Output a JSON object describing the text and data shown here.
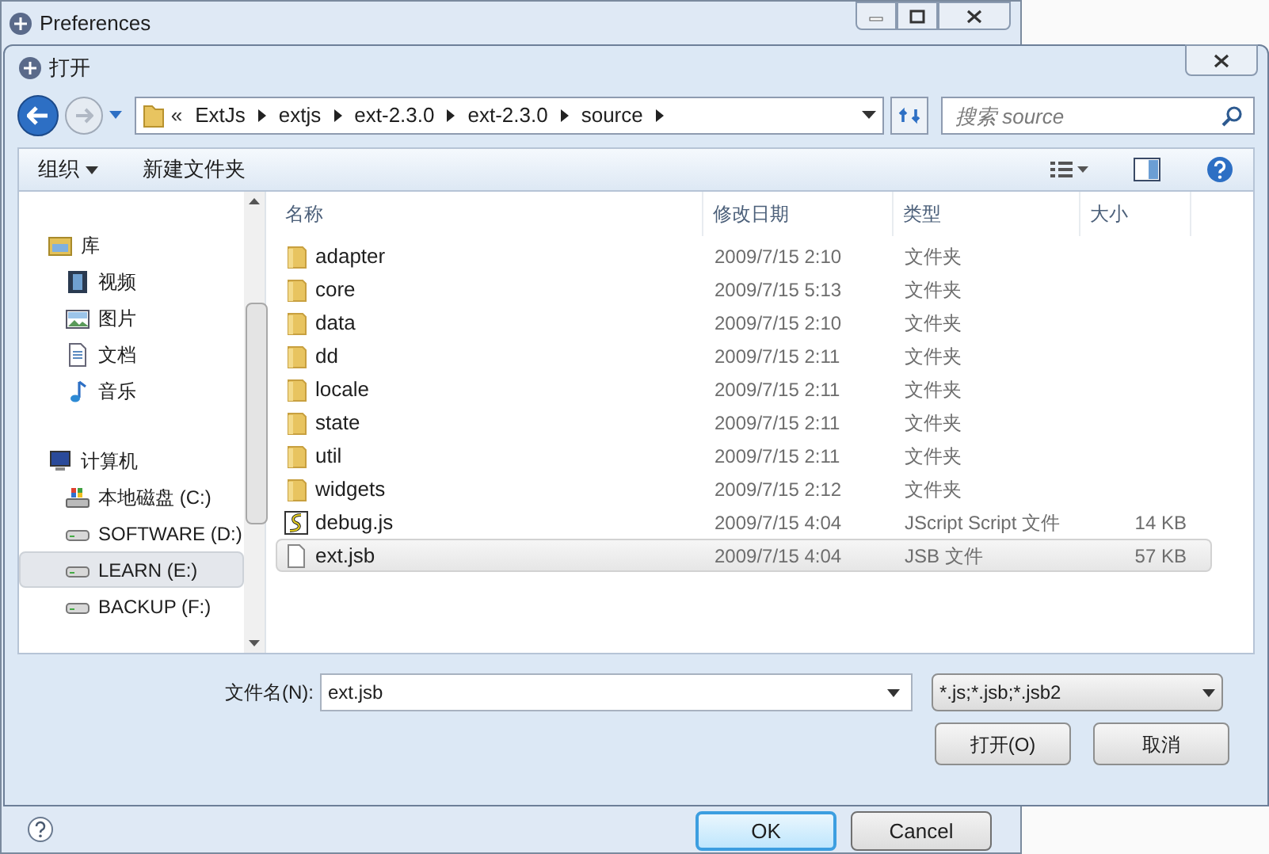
{
  "background_window": {
    "title": "Preferences",
    "buttons": [
      {
        "label": "OK",
        "default": true
      },
      {
        "label": "Cancel",
        "default": false
      }
    ]
  },
  "dialog": {
    "title": "打开",
    "breadcrumb": {
      "overflow": "«",
      "segments": [
        "ExtJs",
        "extjs",
        "ext-2.3.0",
        "ext-2.3.0",
        "source"
      ]
    },
    "search": {
      "placeholder": "搜索 source"
    },
    "toolbar": {
      "organize": "组织",
      "new_folder": "新建文件夹"
    },
    "sidebar": [
      {
        "label": "库",
        "kind": "library",
        "children": [
          {
            "label": "视频",
            "kind": "video",
            "selected": false
          },
          {
            "label": "图片",
            "kind": "picture",
            "selected": false
          },
          {
            "label": "文档",
            "kind": "document",
            "selected": false
          },
          {
            "label": "音乐",
            "kind": "music",
            "selected": false
          }
        ]
      },
      {
        "label": "计算机",
        "kind": "computer",
        "children": [
          {
            "label": "本地磁盘 (C:)",
            "kind": "system-drive",
            "selected": false
          },
          {
            "label": "SOFTWARE (D:)",
            "kind": "drive",
            "selected": false
          },
          {
            "label": "LEARN (E:)",
            "kind": "drive",
            "selected": true
          },
          {
            "label": "BACKUP (F:)",
            "kind": "drive",
            "selected": false
          }
        ]
      }
    ],
    "columns": [
      "名称",
      "修改日期",
      "类型",
      "大小"
    ],
    "files": [
      {
        "name": "adapter",
        "date": "2009/7/15 2:10",
        "type": "文件夹",
        "kind": "folder",
        "selected": false
      },
      {
        "name": "core",
        "date": "2009/7/15 5:13",
        "type": "文件夹",
        "kind": "folder",
        "selected": false
      },
      {
        "name": "data",
        "date": "2009/7/15 2:10",
        "type": "文件夹",
        "kind": "folder",
        "selected": false
      },
      {
        "name": "dd",
        "date": "2009/7/15 2:11",
        "type": "文件夹",
        "kind": "folder",
        "selected": false
      },
      {
        "name": "locale",
        "date": "2009/7/15 2:11",
        "type": "文件夹",
        "kind": "folder",
        "selected": false
      },
      {
        "name": "state",
        "date": "2009/7/15 2:11",
        "type": "文件夹",
        "kind": "folder",
        "selected": false
      },
      {
        "name": "util",
        "date": "2009/7/15 2:11",
        "type": "文件夹",
        "kind": "folder",
        "selected": false
      },
      {
        "name": "widgets",
        "date": "2009/7/15 2:12",
        "type": "文件夹",
        "kind": "folder",
        "selected": false
      },
      {
        "name": "debug.js",
        "date": "2009/7/15 4:04",
        "type": "JScript Script 文件",
        "size": "14 KB",
        "kind": "script",
        "selected": false
      },
      {
        "name": "ext.jsb",
        "date": "2009/7/15 4:04",
        "type": "JSB 文件",
        "size": "57 KB",
        "kind": "file",
        "selected": true
      }
    ],
    "filename": {
      "label": "文件名(N):",
      "value": "ext.jsb"
    },
    "filter": "*.js;*.jsb;*.jsb2",
    "open_button": "打开(O)",
    "cancel_button": "取消"
  }
}
